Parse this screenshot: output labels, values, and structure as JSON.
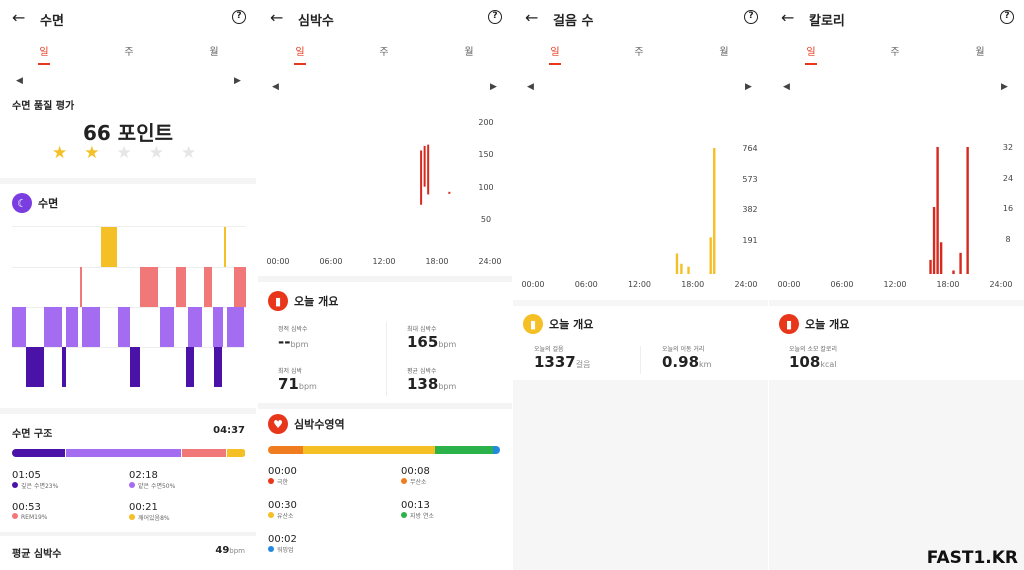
{
  "sleep": {
    "title": "수면",
    "tabs": [
      "일",
      "주",
      "월"
    ],
    "quality_label": "수면 품질 평가",
    "score": "66 포인트",
    "stars_filled": 2,
    "stars_total": 5,
    "section_title": "수면",
    "structure_label": "수면 구조",
    "structure_total": "04:37",
    "stages": [
      {
        "time": "01:05",
        "label": "깊은 수면23%",
        "color": "#4b12a8",
        "pct": 23
      },
      {
        "time": "02:18",
        "label": "얕은 수면50%",
        "color": "#a46cf0",
        "pct": 50
      },
      {
        "time": "00:53",
        "label": "REM19%",
        "color": "#f07878",
        "pct": 19
      },
      {
        "time": "00:21",
        "label": "깨어있음8%",
        "color": "#f5bf26",
        "pct": 8
      }
    ],
    "avg_hr_label": "평균 심박수",
    "avg_hr_value": "49",
    "avg_hr_unit": "bpm"
  },
  "heart": {
    "title": "심박수",
    "tabs": [
      "일",
      "주",
      "월"
    ],
    "overview_title": "오늘 개요",
    "stats": [
      {
        "label": "정적 심박수",
        "value": "--",
        "unit": "bpm"
      },
      {
        "label": "최대 심박수",
        "value": "165",
        "unit": "bpm"
      },
      {
        "label": "최저 심박",
        "value": "71",
        "unit": "bpm"
      },
      {
        "label": "평균 심박수",
        "value": "138",
        "unit": "bpm"
      }
    ],
    "zones_title": "심박수영역",
    "zones": [
      {
        "time": "00:00",
        "label": "극한",
        "color": "#e8361b"
      },
      {
        "time": "00:08",
        "label": "무산소",
        "color": "#f07c20"
      },
      {
        "time": "00:30",
        "label": "유산소",
        "color": "#f5bf26"
      },
      {
        "time": "00:13",
        "label": "지방 연소",
        "color": "#2cb24a"
      },
      {
        "time": "00:02",
        "label": "워밍업",
        "color": "#2489e0"
      }
    ]
  },
  "steps": {
    "title": "걸음 수",
    "tabs": [
      "일",
      "주",
      "월"
    ],
    "overview_title": "오늘 개요",
    "stats": [
      {
        "label": "오늘의 걸음",
        "value": "1337",
        "unit": "걸음"
      },
      {
        "label": "오늘의 이동 거리",
        "value": "0.98",
        "unit": "km"
      }
    ]
  },
  "calories": {
    "title": "칼로리",
    "tabs": [
      "일",
      "주",
      "월"
    ],
    "overview_title": "오늘 개요",
    "stats": [
      {
        "label": "오늘의 소모 칼로리",
        "value": "108",
        "unit": "kcal"
      }
    ]
  },
  "chart_data": [
    {
      "type": "bar",
      "chart": "heart_rate_day",
      "x_ticks": [
        "00:00",
        "06:00",
        "12:00",
        "18:00",
        "24:00"
      ],
      "y_ticks": [
        "200",
        "150",
        "100",
        "50"
      ],
      "color": "#d62a1e",
      "ranges": [
        {
          "x": 16.2,
          "low": 72,
          "high": 156
        },
        {
          "x": 16.6,
          "low": 100,
          "high": 163
        },
        {
          "x": 17.0,
          "low": 88,
          "high": 165
        },
        {
          "x": 19.4,
          "low": 90,
          "high": 92
        }
      ]
    },
    {
      "type": "bar",
      "chart": "steps_day",
      "x_ticks": [
        "00:00",
        "06:00",
        "12:00",
        "18:00",
        "24:00"
      ],
      "y_ticks": [
        "764",
        "573",
        "382",
        "191"
      ],
      "color": "#f5bf26",
      "x": [
        16.2,
        16.7,
        17.5,
        20.0,
        20.4
      ],
      "values": [
        140,
        70,
        50,
        250,
        860
      ]
    },
    {
      "type": "bar",
      "chart": "calories_day",
      "x_ticks": [
        "00:00",
        "06:00",
        "12:00",
        "18:00",
        "24:00"
      ],
      "y_ticks": [
        "32",
        "24",
        "16",
        "8"
      ],
      "color": "#d62a1e",
      "x": [
        16.0,
        16.4,
        16.8,
        17.2,
        18.6,
        19.4,
        20.2
      ],
      "values": [
        4,
        19,
        36,
        9,
        1,
        6,
        36
      ]
    }
  ],
  "watermark": "FAST1.KR"
}
